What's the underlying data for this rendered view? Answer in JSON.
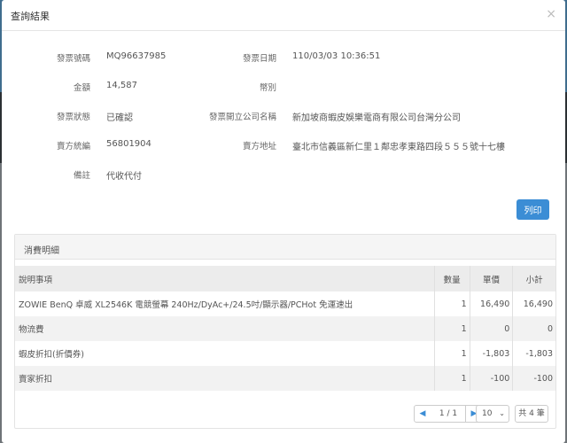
{
  "modal": {
    "title": "查詢結果",
    "close_icon": "×"
  },
  "invoice": {
    "number_label": "發票號碼",
    "number": "MQ96637985",
    "date_label": "發票日期",
    "date": "110/03/03 10:36:51",
    "amount_label": "金額",
    "amount": "14,587",
    "currency_label": "幣別",
    "currency": "",
    "status_label": "發票狀態",
    "status": "已確認",
    "company_label": "發票開立公司名稱",
    "company": "新加坡商蝦皮娛樂電商有限公司台灣分公司",
    "buyer_id_label": "賣方統編",
    "buyer_id": "56801904",
    "seller_address_label": "賣方地址",
    "seller_address": "臺北市信義區新仁里１鄰忠孝東路四段５５５號十七樓",
    "note_label": "備註",
    "note": "代收代付"
  },
  "print_label": "列印",
  "details": {
    "panel_title": "消費明細",
    "headers": {
      "desc": "說明事項",
      "qty": "數量",
      "price": "單價",
      "subtotal": "小計"
    },
    "rows": [
      {
        "desc": "ZOWIE BenQ 卓威 XL2546K 電競螢幕 240Hz/DyAc+/24.5吋/顯示器/PCHot 免運速出",
        "qty": "1",
        "price": "16,490",
        "subtotal": "16,490"
      },
      {
        "desc": "物流費",
        "qty": "1",
        "price": "0",
        "subtotal": "0"
      },
      {
        "desc": "蝦皮折扣(折價券)",
        "qty": "1",
        "price": "-1,803",
        "subtotal": "-1,803"
      },
      {
        "desc": "賣家折扣",
        "qty": "1",
        "price": "-100",
        "subtotal": "-100"
      }
    ]
  },
  "pager": {
    "prev_icon": "◀",
    "info": "1 / 1",
    "next_icon": "▶",
    "page_size": "10",
    "caret_icon": "⌄",
    "total": "共 4 筆"
  }
}
